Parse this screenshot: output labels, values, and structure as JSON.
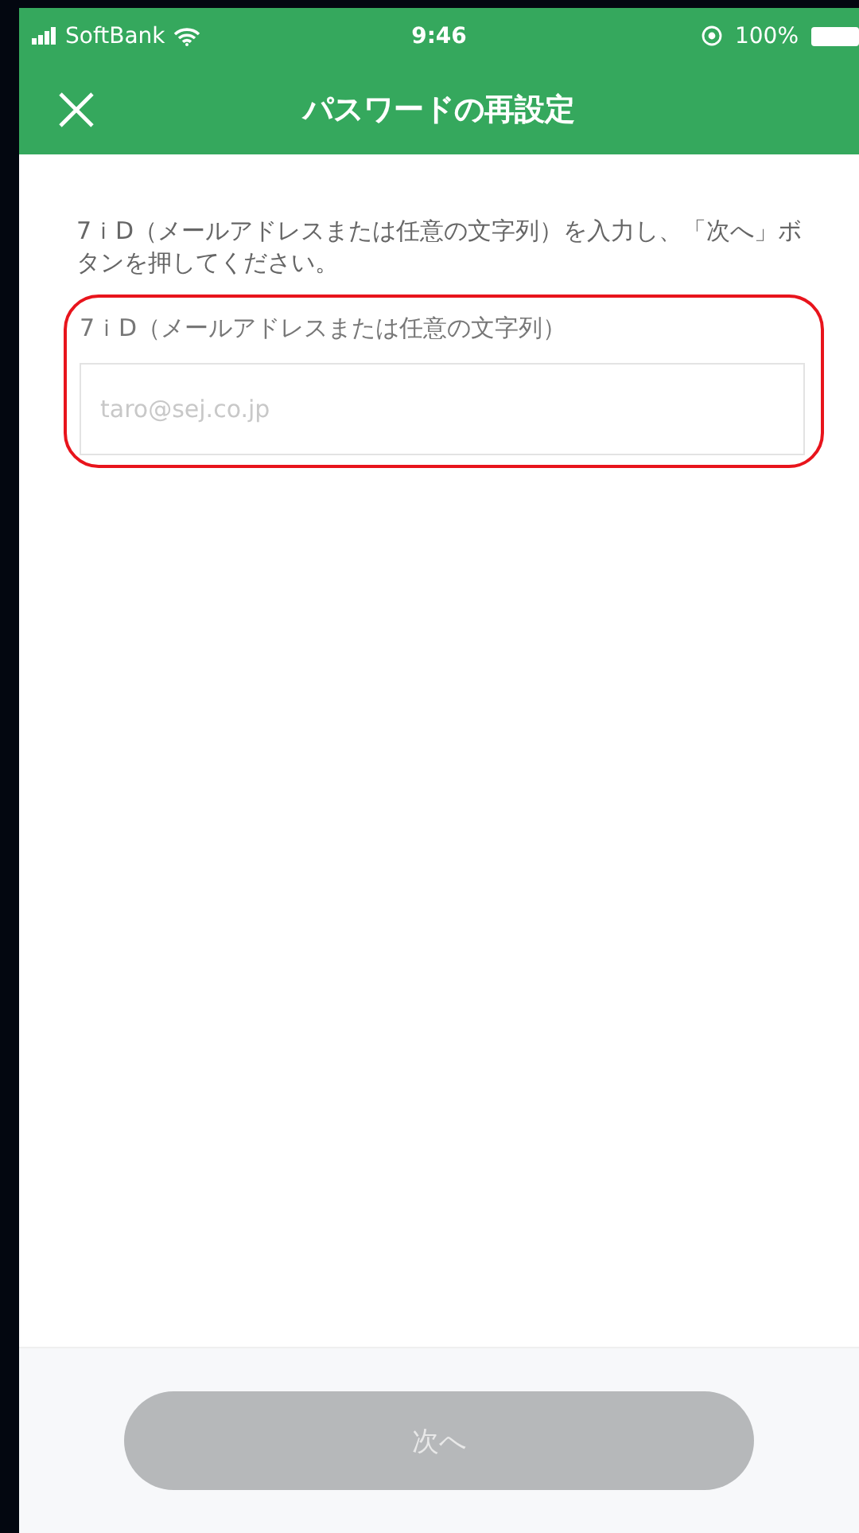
{
  "status_bar": {
    "carrier": "SoftBank",
    "time": "9:46",
    "battery": "100%"
  },
  "nav": {
    "title": "パスワードの再設定"
  },
  "intro": "7ｉD（メールアドレスまたは任意の文字列）を入力し、「次へ」ボタンを押してください。",
  "field": {
    "label": "7ｉD（メールアドレスまたは任意の文字列）",
    "placeholder": "taro@sej.co.jp"
  },
  "footer": {
    "button": {
      "label": "次へ",
      "disabled": true
    }
  }
}
